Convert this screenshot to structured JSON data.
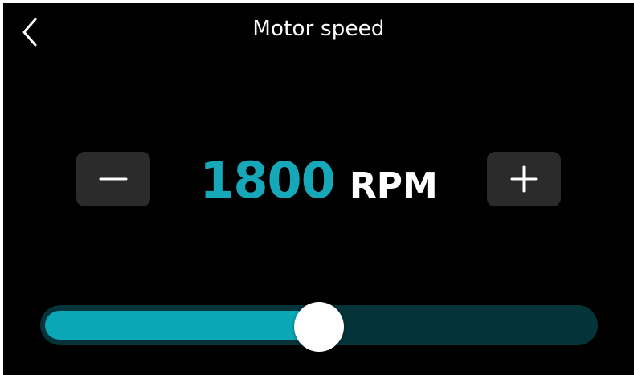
{
  "header": {
    "title": "Motor speed",
    "back_icon": "chevron-left-icon"
  },
  "speed": {
    "value": "1800",
    "unit": "RPM",
    "decrease_icon": "minus-icon",
    "increase_icon": "plus-icon"
  },
  "slider": {
    "level_fraction": 0.5
  },
  "colors": {
    "background": "#000000",
    "accent": "#16a8b8",
    "track": "#04333a",
    "button": "#2b2b2b",
    "text": "#ffffff"
  }
}
